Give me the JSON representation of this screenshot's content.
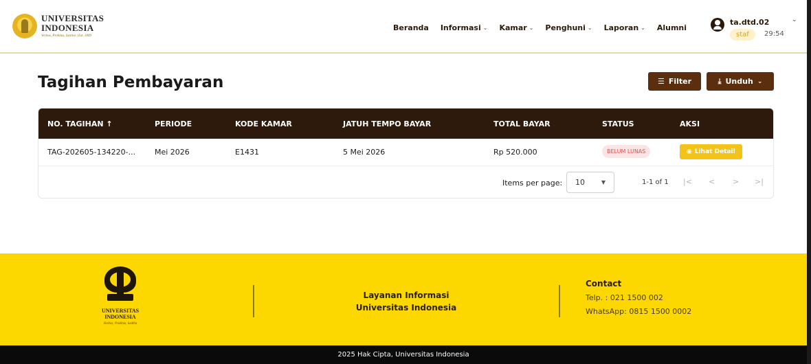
{
  "header": {
    "logo": {
      "line1": "UNIVERSITAS",
      "line2": "INDONESIA",
      "motto": "Veritas, Probitas, Iustitia | Est. 1849"
    },
    "nav": [
      {
        "label": "Beranda",
        "dropdown": false
      },
      {
        "label": "Informasi",
        "dropdown": true
      },
      {
        "label": "Kamar",
        "dropdown": true
      },
      {
        "label": "Penghuni",
        "dropdown": true
      },
      {
        "label": "Laporan",
        "dropdown": true
      },
      {
        "label": "Alumni",
        "dropdown": false
      }
    ],
    "user": {
      "name": "ta.dtd.02",
      "role": "staf",
      "timer": "29:54"
    }
  },
  "main": {
    "title": "Tagihan Pembayaran",
    "filter_label": "Filter",
    "download_label": "Unduh",
    "table": {
      "columns": [
        "NO. TAGIHAN",
        "PERIODE",
        "KODE KAMAR",
        "JATUH TEMPO BAYAR",
        "TOTAL BAYAR",
        "STATUS",
        "AKSI"
      ],
      "sort_indicator": "↑",
      "rows": [
        {
          "no_tagihan": "TAG-202605-134220-...",
          "periode": "Mei 2026",
          "kode_kamar": "E1431",
          "jatuh_tempo": "5 Mei 2026",
          "total_bayar": "Rp 520.000",
          "status": "BELUM LUNAS",
          "aksi": "Lihat Detail"
        }
      ]
    },
    "pagination": {
      "items_per_page_label": "Items per page:",
      "items_per_page": "10",
      "range": "1-1 of 1"
    }
  },
  "footer": {
    "logo": {
      "line1": "UNIVERSITAS",
      "line2": "INDONESIA",
      "motto": "Veritas, Probitas, Iustitia"
    },
    "service_line1": "Layanan Informasi",
    "service_line2": "Universitas Indonesia",
    "contact_title": "Contact",
    "phone": "Telp. : 021 1500 002",
    "whatsapp": "WhatsApp: 0815 1500 0002",
    "copyright": "2025 Hak Cipta, Universitas Indonesia"
  },
  "colors": {
    "primary": "#5a2e0e",
    "table_header": "#2e1a0c",
    "accent_yellow": "#fdd700",
    "status_unpaid": "#e0524d"
  }
}
